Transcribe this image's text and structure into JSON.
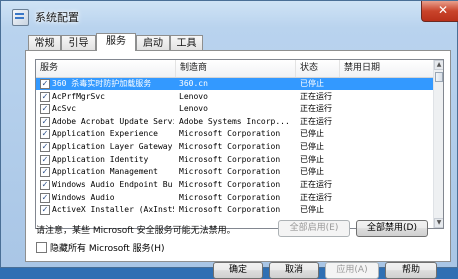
{
  "window": {
    "title": "系统配置",
    "close": "✕"
  },
  "tabs": [
    {
      "label": "常规"
    },
    {
      "label": "引导"
    },
    {
      "label": "服务"
    },
    {
      "label": "启动"
    },
    {
      "label": "工具"
    }
  ],
  "columns": {
    "service": "服务",
    "manufacturer": "制造商",
    "status": "状态",
    "disabled_date": "禁用日期"
  },
  "rows": [
    {
      "checked": true,
      "name": "360 杀毒实时防护加载服务",
      "manufacturer": "360.cn",
      "status": "已停止",
      "selected": true
    },
    {
      "checked": true,
      "name": "AcPrfMgrSvc",
      "manufacturer": "Lenovo",
      "status": "正在运行"
    },
    {
      "checked": true,
      "name": "AcSvc",
      "manufacturer": "Lenovo",
      "status": "正在运行"
    },
    {
      "checked": true,
      "name": "Adobe Acrobat Update Service",
      "manufacturer": "Adobe Systems Incorp...",
      "status": "正在运行"
    },
    {
      "checked": true,
      "name": "Application Experience",
      "manufacturer": "Microsoft Corporation",
      "status": "已停止"
    },
    {
      "checked": true,
      "name": "Application Layer Gateway...",
      "manufacturer": "Microsoft Corporation",
      "status": "已停止"
    },
    {
      "checked": true,
      "name": "Application Identity",
      "manufacturer": "Microsoft Corporation",
      "status": "已停止"
    },
    {
      "checked": true,
      "name": "Application Management",
      "manufacturer": "Microsoft Corporation",
      "status": "已停止"
    },
    {
      "checked": true,
      "name": "Windows Audio Endpoint Bu...",
      "manufacturer": "Microsoft Corporation",
      "status": "正在运行"
    },
    {
      "checked": true,
      "name": "Windows Audio",
      "manufacturer": "Microsoft Corporation",
      "status": "正在运行"
    },
    {
      "checked": true,
      "name": "ActiveX Installer (AxInstSV)",
      "manufacturer": "Microsoft Corporation",
      "status": "已停止"
    }
  ],
  "note": "请注意，某些 Microsoft 安全服务可能无法禁用。",
  "buttons": {
    "enable_all": "全部启用(E)",
    "disable_all": "全部禁用(D)",
    "ok": "确定",
    "cancel": "取消",
    "apply": "应用(A)",
    "help": "帮助"
  },
  "hide_ms_label": "隐藏所有 Microsoft 服务(H)"
}
